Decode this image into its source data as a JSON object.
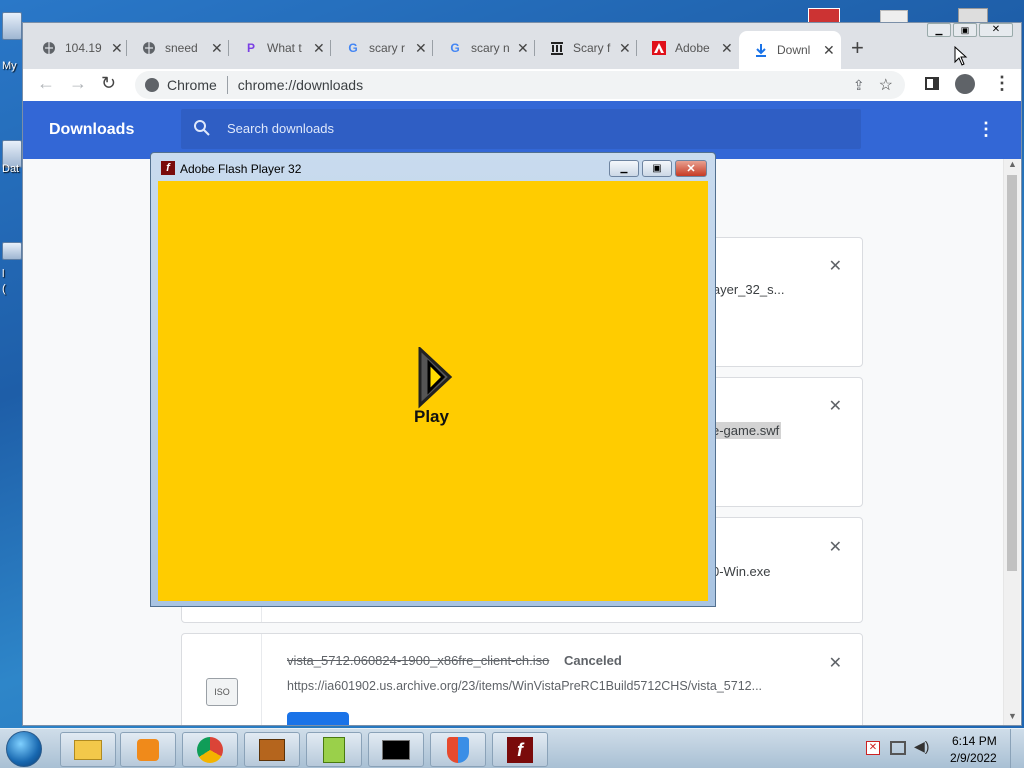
{
  "desktop": {
    "labels": [
      "My",
      "Dat",
      "l",
      "("
    ]
  },
  "chrome": {
    "tabs": [
      {
        "title": "104.19",
        "favicon": "globe-icon"
      },
      {
        "title": "sneed",
        "favicon": "globe-icon"
      },
      {
        "title": "What t",
        "favicon": "picsart-icon"
      },
      {
        "title": "scary r",
        "favicon": "google-icon"
      },
      {
        "title": "scary n",
        "favicon": "google-icon"
      },
      {
        "title": "Scary f",
        "favicon": "archive-icon"
      },
      {
        "title": "Adobe",
        "favicon": "adobe-icon"
      },
      {
        "title": "Downl",
        "favicon": "download-icon"
      }
    ],
    "new_tab_label": "+",
    "omnibox": {
      "site_label": "Chrome",
      "url": "chrome://downloads"
    }
  },
  "downloads": {
    "title": "Downloads",
    "search_placeholder": "Search downloads",
    "items": [
      {
        "name": "layer_32_s...",
        "status": "",
        "url": ""
      },
      {
        "name": "e-game.swf",
        "status": "",
        "url": ""
      },
      {
        "name": "0-Win.exe",
        "status": "",
        "url": ""
      },
      {
        "name": "vista_5712.060824-1900_x86fre_client-ch.iso",
        "status": "Canceled",
        "url": "https://ia601902.us.archive.org/23/items/WinVistaPreRC1Build5712CHS/vista_5712..."
      }
    ],
    "file_icon_label": "ISO"
  },
  "flash": {
    "title": "Adobe Flash Player 32",
    "play_label": "Play",
    "stage_color": "#ffcc00"
  },
  "taskbar": {
    "time": "6:14 PM",
    "date": "2/9/2022"
  }
}
